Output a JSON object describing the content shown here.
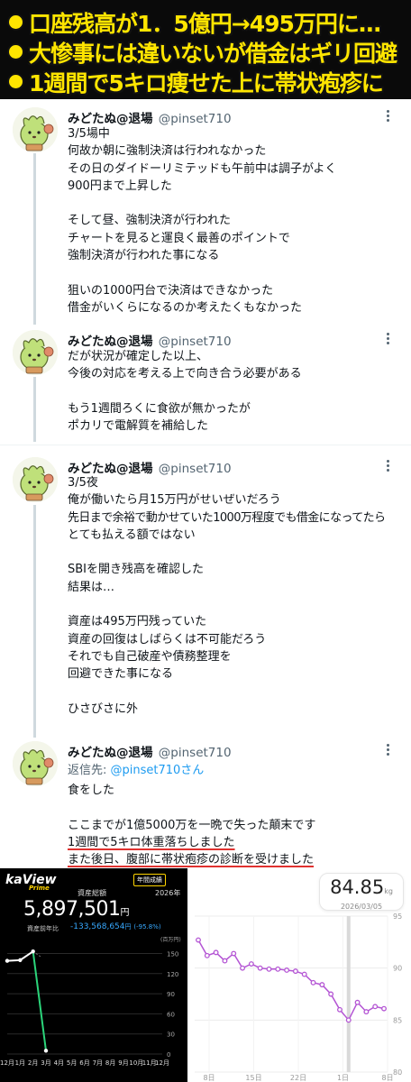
{
  "banner": {
    "lines": [
      "口座残高が1．5億円→495万円に…",
      "大惨事には違いないが借金はギリ回避",
      "1週間で5キロ痩せた上に帯状疱疹に"
    ]
  },
  "colors": {
    "banner_text": "#ffe500",
    "link": "#1d9bf0",
    "underline": "#e0312f",
    "line_series": "#b455d4",
    "drop_series": "#2bd47a"
  },
  "tweets": [
    {
      "name": "みどたぬ@退場",
      "handle": "@pinset710",
      "lines": [
        "3/5場中",
        "何故か朝に強制決済は行われなかった",
        "その日のダイドーリミテッドも午前中は調子がよく",
        "900円まで上昇した",
        "",
        "そして昼、強制決済が行われた",
        "チャートを見ると運良く最善のポイントで",
        "強制決済が行われた事になる",
        "",
        "狙いの1000円台で決済はできなかった",
        "借金がいくらになるのか考えたくもなかった"
      ]
    },
    {
      "name": "みどたぬ@退場",
      "handle": "@pinset710",
      "lines": [
        "だが状況が確定した以上、",
        "今後の対応を考える上で向き合う必要がある",
        "",
        "もう1週間ろくに食欲が無かったが",
        "ポカリで電解質を補給した"
      ]
    },
    {
      "name": "みどたぬ@退場",
      "handle": "@pinset710",
      "lines": [
        "3/5夜",
        "俺が働いたら月15万円がせいぜいだろう",
        "先日まで余裕で動かせていた1000万程度でも借金になってたら",
        "とても払える額ではない",
        "",
        "SBIを開き残高を確認した",
        "結果は…",
        "",
        "資産は495万円残っていた",
        "資産の回復はしばらくは不可能だろう",
        "それでも自己破産や債務整理を",
        "回避できた事になる",
        "",
        "ひさびさに外"
      ]
    },
    {
      "name": "みどたぬ@退場",
      "handle": "@pinset710",
      "reply_prefix": "返信先: ",
      "reply_mention": "@pinset710さん",
      "lines": [
        "食をした",
        "",
        "ここまでが1億5000万を一晩で失った顛末です",
        "1週間で5キロ体重落ちしました",
        "また後日、腹部に帯状疱疹の診断を受けました"
      ]
    }
  ],
  "asset_panel": {
    "logo": "kaView",
    "logo_sub": "Prime",
    "badge": "年間成績",
    "title": "資産総額",
    "year": "2026年",
    "total": "5,897,501",
    "total_unit": "円",
    "prev_label": "資産前年比",
    "prev_value": "-133,568,654",
    "prev_unit": "円",
    "prev_pct": "(-95.8%)",
    "y_unit": "(百万円)",
    "chart_data": {
      "type": "line",
      "x": [
        "12月",
        "1月",
        "2月",
        "3月",
        "4月",
        "5月",
        "6月",
        "7月",
        "8月",
        "9月",
        "10月",
        "11月",
        "12月"
      ],
      "series": [
        {
          "values": [
            139,
            140,
            153,
            5
          ]
        }
      ],
      "ylim": [
        0,
        160
      ],
      "yticks": [
        0,
        30,
        60,
        90,
        120,
        150
      ]
    }
  },
  "weight_panel": {
    "weight": "84.85",
    "unit": "kg",
    "date": "2026/03/05",
    "chart_data": {
      "type": "line",
      "x_ticks": [
        "8日",
        "15日",
        "22日",
        "1日",
        "8日"
      ],
      "ylim": [
        80,
        95
      ],
      "yticks": [
        80,
        85,
        90,
        95
      ],
      "series": [
        {
          "values": [
            92.7,
            91.2,
            91.5,
            90.7,
            91.4,
            90.0,
            90.4,
            90.0,
            89.9,
            89.9,
            89.8,
            89.7,
            89.4,
            88.6,
            88.4,
            87.5,
            86.0,
            85.0,
            86.7,
            85.8,
            86.3,
            86.1
          ]
        }
      ]
    }
  }
}
